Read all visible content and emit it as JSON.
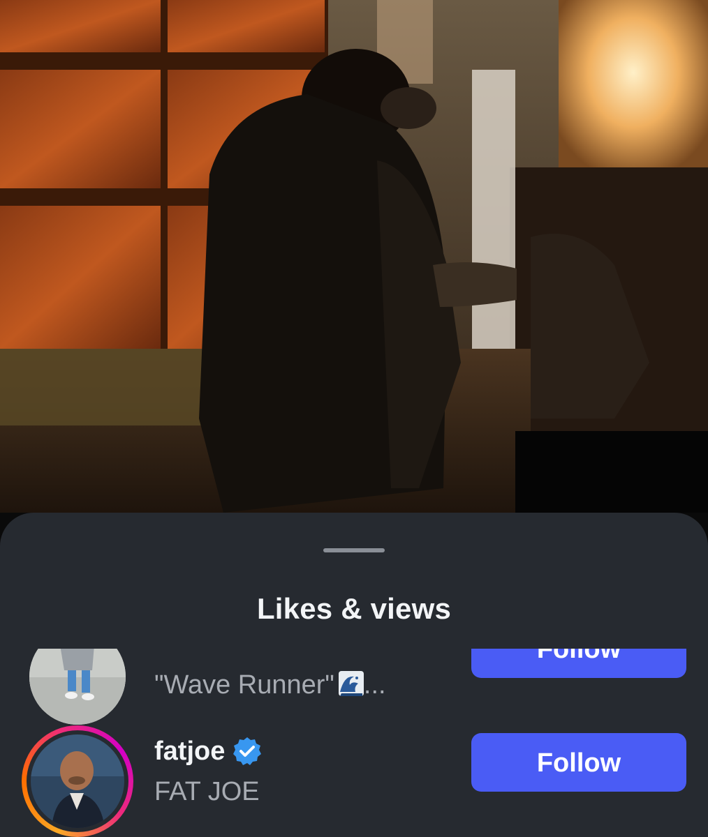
{
  "sheet": {
    "title": "Likes & views"
  },
  "list": [
    {
      "username": "",
      "subtitle_text": "\"Wave Runner\"",
      "subtitle_emoji": "wave-emoji",
      "subtitle_ellipsis": "...",
      "follow_label": "Follow",
      "verified": false,
      "story_ring": false
    },
    {
      "username": "fatjoe",
      "subtitle": "FAT JOE",
      "follow_label": "Follow",
      "verified": true,
      "story_ring": true
    }
  ],
  "colors": {
    "sheet_bg": "#262a30",
    "follow_button": "#4a5cf5",
    "verified_badge": "#3897f0",
    "notification_dot": "#e0243c"
  },
  "icons": {
    "verified": "verified-badge-icon",
    "grabber": "sheet-grabber"
  }
}
